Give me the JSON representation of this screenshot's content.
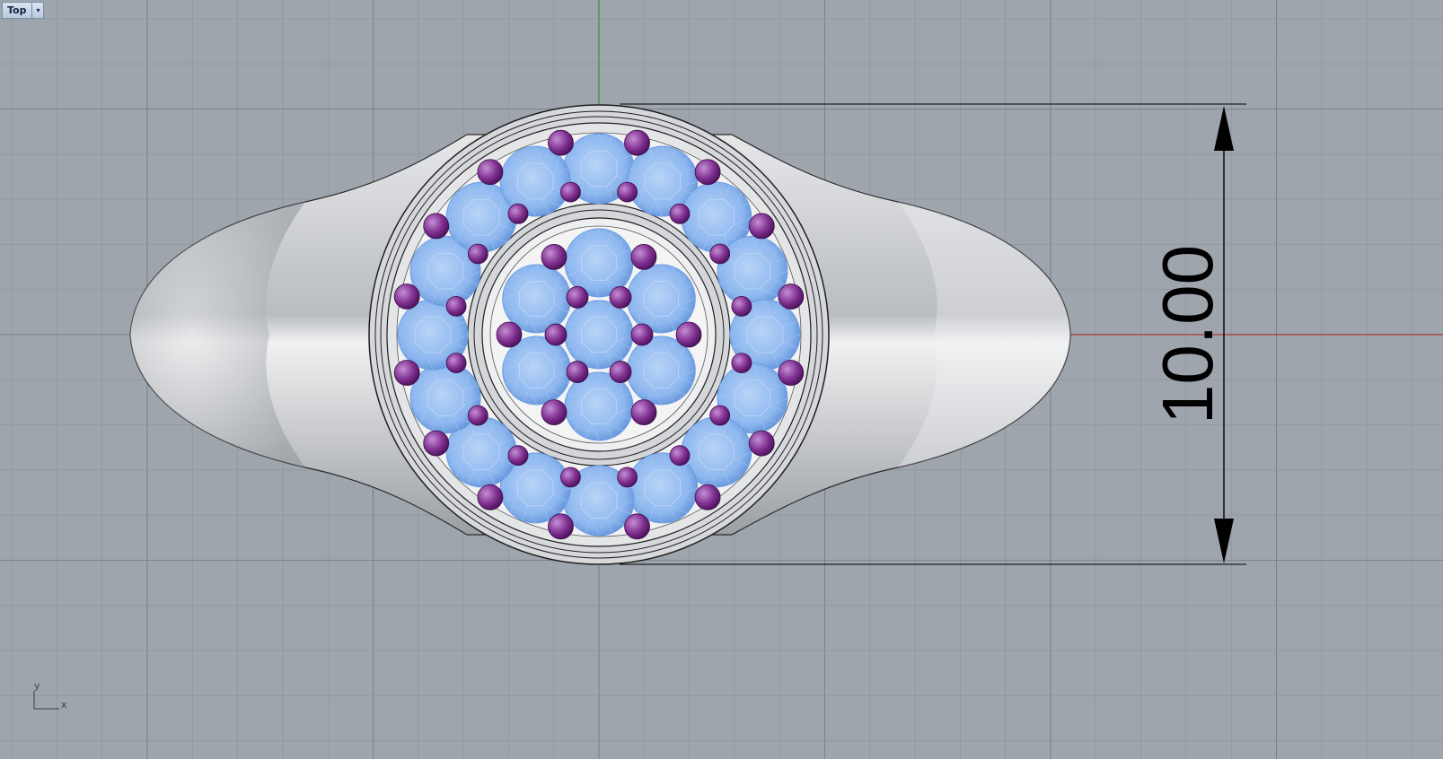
{
  "viewport": {
    "name": "Top",
    "dropdown_glyph": "▾"
  },
  "dimension": {
    "text": "10.00"
  },
  "axis_icon": {
    "y_label": "y",
    "x_label": "x"
  },
  "colors": {
    "background": "#9ea5ad",
    "grid_minor": "#8f969e",
    "grid_major": "#7b828b",
    "x_axis": "#a33a3a",
    "y_axis": "#2f9b39",
    "metal": "#c9ccd0",
    "gem": "#8fbaf2",
    "prong": "#7b2d8c",
    "dimension_line": "#000000"
  }
}
